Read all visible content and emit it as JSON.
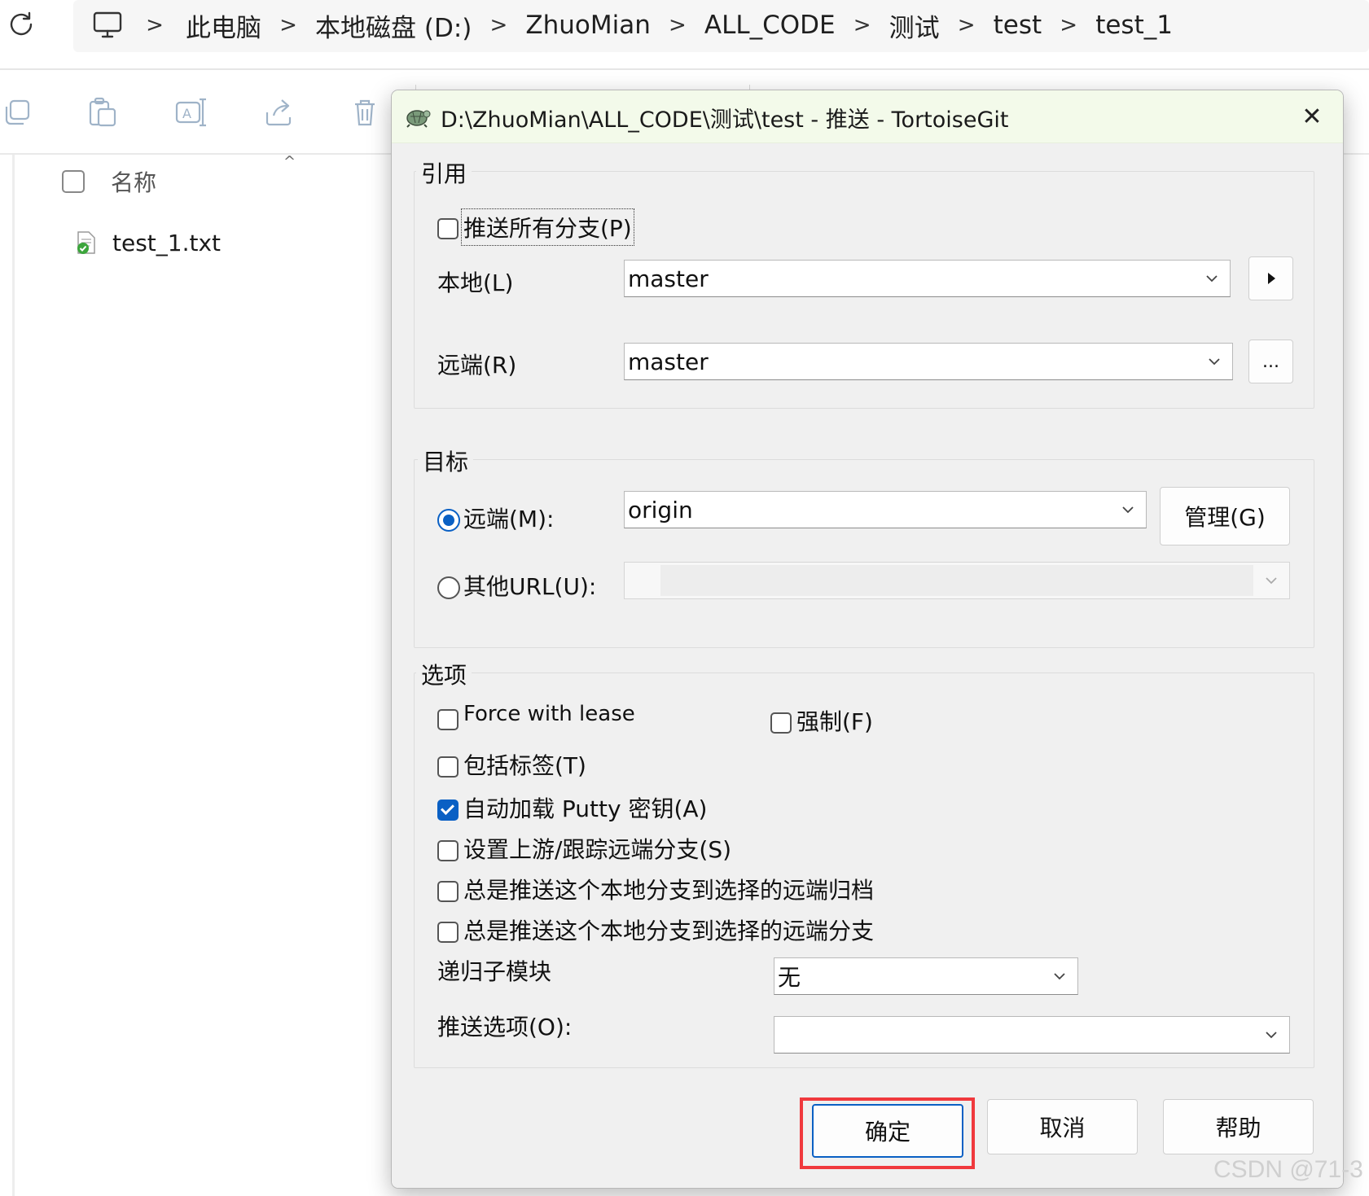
{
  "explorer": {
    "breadcrumb": [
      "此电脑",
      "本地磁盘 (D:)",
      "ZhuoMian",
      "ALL_CODE",
      "测试",
      "test",
      "test_1"
    ],
    "column_header": "名称",
    "files": [
      {
        "name": "test_1.txt",
        "icon": "git-clean-file-icon"
      }
    ]
  },
  "dialog": {
    "title": "D:\\ZhuoMian\\ALL_CODE\\测试\\test - 推送 - TortoiseGit",
    "ref_group": {
      "title": "引用",
      "push_all_label": "推送所有分支(P)",
      "push_all_checked": false,
      "local_label": "本地(L)",
      "local_value": "master",
      "remote_label": "远端(R)",
      "remote_value": "master",
      "browse_label": "..."
    },
    "target_group": {
      "title": "目标",
      "remote_radio_label": "远端(M):",
      "remote_radio_selected": true,
      "remote_value": "origin",
      "manage_label": "管理(G)",
      "other_url_label": "其他URL(U):",
      "other_url_value": ""
    },
    "options_group": {
      "title": "选项",
      "force_with_lease": "Force with lease",
      "force": "强制(F)",
      "include_tags": "包括标签(T)",
      "autoload_putty": "自动加载 Putty 密钥(A)",
      "autoload_putty_checked": true,
      "set_upstream": "设置上游/跟踪远端分支(S)",
      "always_push_archive": "总是推送这个本地分支到选择的远端归档",
      "always_push_branch": "总是推送这个本地分支到选择的远端分支",
      "recurse_label": "递归子模块",
      "recurse_value": "无",
      "push_options_label": "推送选项(O):",
      "push_options_value": ""
    },
    "buttons": {
      "ok": "确定",
      "cancel": "取消",
      "help": "帮助"
    }
  },
  "watermark": "CSDN @71-3",
  "colors": {
    "accent": "#0a60c4",
    "highlight": "#f0393d",
    "title_bg": "#f3faea"
  }
}
